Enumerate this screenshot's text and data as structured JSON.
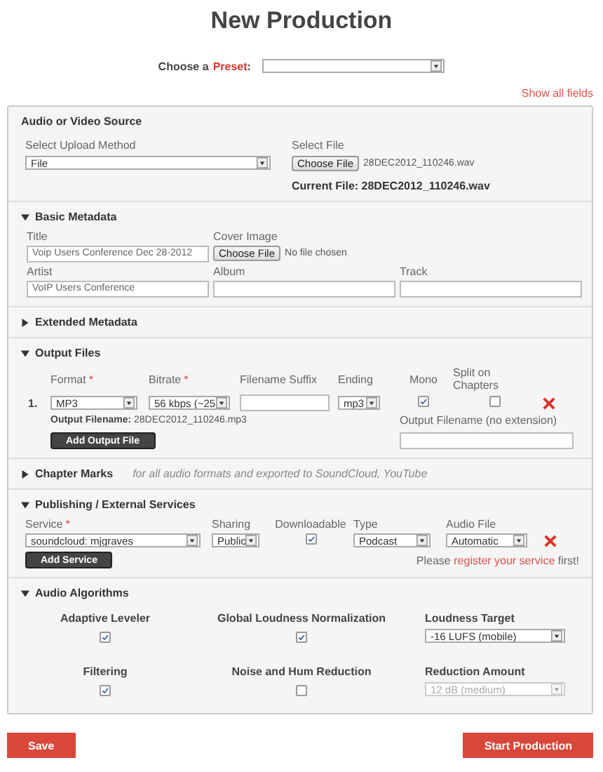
{
  "title": "New Production",
  "preset": {
    "label": "Choose a",
    "link": "Preset",
    "suffix": ":"
  },
  "show_all_fields": "Show all fields",
  "audio_source": {
    "heading": "Audio or Video Source",
    "upload_label": "Select Upload Method",
    "upload_value": "File",
    "file_label": "Select File",
    "file_button": "Choose File",
    "file_name": "28DEC2012_110246.wav",
    "current_file": "Current File: 28DEC2012_110246.wav"
  },
  "basic_metadata": {
    "heading": "Basic Metadata",
    "expanded": true,
    "fields": [
      {
        "kind": "text",
        "label": "Title",
        "value": "Voip Users Conference Dec 28-2012"
      },
      {
        "kind": "file",
        "label": "Cover Image",
        "button": "Choose File",
        "status": "No file chosen"
      },
      {
        "kind": "text",
        "label": "Artist",
        "value": "VoIP Users Conference"
      },
      {
        "kind": "text",
        "label": "Album"
      },
      {
        "kind": "text",
        "label": "Track"
      }
    ]
  },
  "extended_metadata": {
    "heading": "Extended Metadata",
    "expanded": false
  },
  "output_files": {
    "heading": "Output Files",
    "expanded": true,
    "columns": [
      {
        "label": "Format",
        "marker": "*"
      },
      {
        "label": "Bitrate",
        "marker": "*"
      },
      {
        "label": "Filename Suffix"
      },
      {
        "label": "Ending"
      },
      {
        "label": "Mono"
      },
      {
        "label": "Split on Chapters"
      }
    ],
    "rows": [
      {
        "number": "1.",
        "format": "MP3",
        "bitrate": "56 kbps (~25",
        "ending": "mp3",
        "mono": true,
        "split": false,
        "filename_label": "Output Filename:",
        "filename": "28DEC2012_110246.mp3",
        "custom_label": "Output Filename (no extension)"
      }
    ],
    "add_button": "Add Output File"
  },
  "chapter_marks": {
    "heading": "Chapter Marks",
    "expanded": false,
    "note": "for all audio formats and exported to SoundCloud, YouTube"
  },
  "publishing": {
    "heading": "Publishing / External Services",
    "expanded": true,
    "columns": [
      {
        "label": "Service",
        "marker": "*"
      },
      {
        "label": "Sharing"
      },
      {
        "label": "Downloadable"
      },
      {
        "label": "Type"
      },
      {
        "label": "Audio File"
      }
    ],
    "rows": [
      {
        "service": "soundcloud: mjgraves",
        "sharing": "Public",
        "downloadable": true,
        "type": "Podcast",
        "audio_file": "Automatic"
      }
    ],
    "add_button": "Add Service",
    "notice": {
      "before": "Please",
      "link": "register your service",
      "after": "first!"
    }
  },
  "audio_algorithms": {
    "heading": "Audio Algorithms",
    "expanded": true,
    "items": [
      {
        "kind": "checkbox",
        "label": "Adaptive Leveler",
        "checked": true
      },
      {
        "kind": "checkbox",
        "label": "Global Loudness Normalization",
        "checked": true
      },
      {
        "kind": "select",
        "label": "Loudness Target",
        "value": "-16 LUFS (mobile)",
        "disabled": false
      },
      {
        "kind": "checkbox",
        "label": "Filtering",
        "checked": true
      },
      {
        "kind": "checkbox",
        "label": "Noise and Hum Reduction",
        "checked": false
      },
      {
        "kind": "select",
        "label": "Reduction Amount",
        "value": "12 dB (medium)",
        "disabled": true
      }
    ]
  },
  "buttons": [
    "Save",
    "Start Production"
  ]
}
